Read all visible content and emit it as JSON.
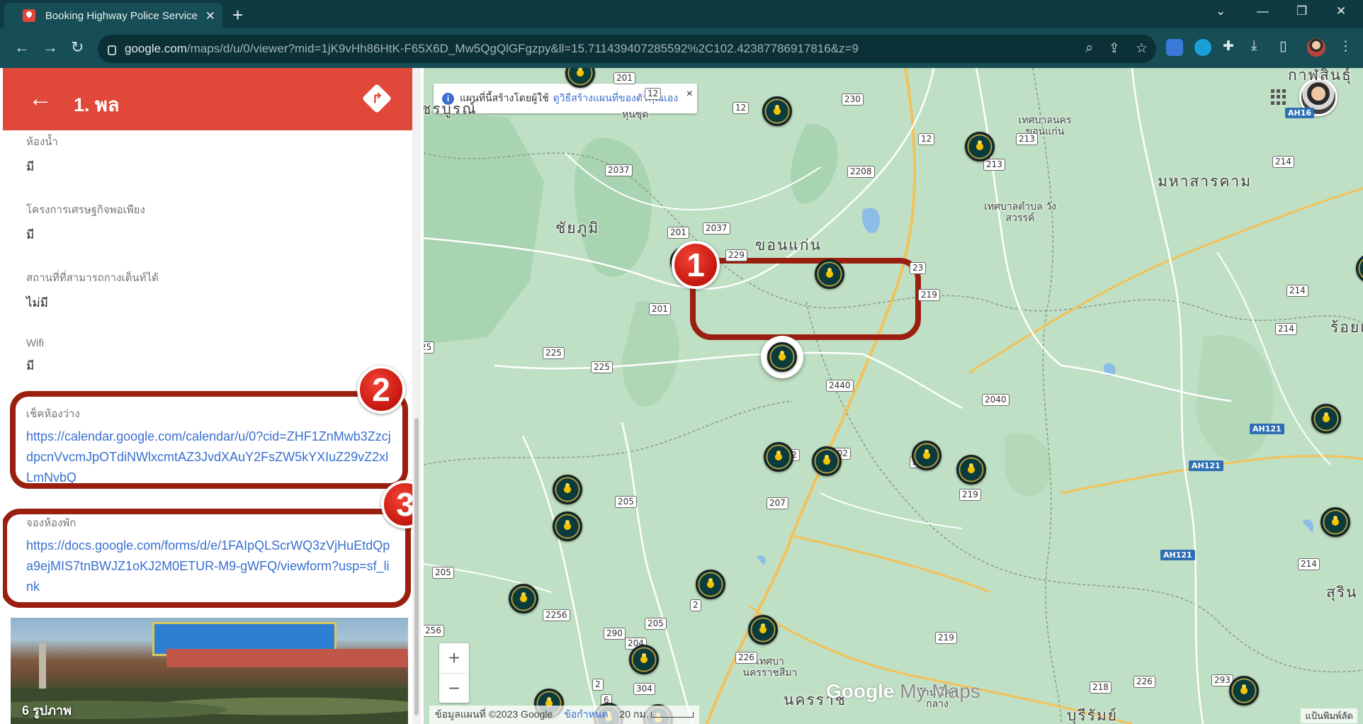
{
  "browser": {
    "tab_title": "Booking Highway Police Service",
    "url_host": "google.com",
    "url_path": "/maps/d/u/0/viewer?mid=1jK9vHh86HtK-F65X6D_Mw5QgQlGFgzpy&ll=15.711439407285592%2C102.42387786917816&z=9",
    "icons": {
      "back": "back-arrow-icon",
      "forward": "forward-arrow-icon",
      "reload": "reload-icon",
      "zoom": "zoom-icon",
      "share": "share-icon",
      "bookmark": "star-icon",
      "extensions": "puzzle-icon",
      "download": "download-icon",
      "sidepanel": "sidepanel-icon"
    }
  },
  "panel": {
    "title": "1. พล",
    "fields": [
      {
        "label": "ห้องน้ำ",
        "value": "มี"
      },
      {
        "label": "โครงการเศรษฐกิจพอเพียง",
        "value": "มี"
      },
      {
        "label": "สถานที่ที่สามารถกางเต็นท์ได้",
        "value": "ไม่มี"
      },
      {
        "label": "Wifi",
        "value": "มี"
      }
    ],
    "check_room": {
      "label": "เช็คห้องว่าง",
      "link": "https://calendar.google.com/calendar/u/0?cid=ZHF1ZnMwb3ZzcjdpcnVvcmJpOTdiNWlxcmtAZ3JvdXAuY2FsZW5kYXIuZ29vZ2xlLmNvbQ"
    },
    "book_room": {
      "label": "จองห้องพัก",
      "link": "https://docs.google.com/forms/d/e/1FAIpQLScrWQ3zVjHuEtdQpa9ejMIS7tnBWJZ1oKJ2M0ETUR-M9-gWFQ/viewform?usp=sf_link"
    },
    "photo_caption": "6 รูปภาพ",
    "badges": [
      "1",
      "2",
      "3"
    ]
  },
  "map": {
    "info_text": "แผนที่นี้สร้างโดยผู้ใช้",
    "info_link": "ดูวิธีสร้างแผนที่ของตัวคุณเอง",
    "info_close": "×",
    "zoom_in": "+",
    "zoom_out": "−",
    "watermark_google": "Google",
    "watermark_mymaps": "My Maps",
    "attribution": "ข้อมูลแผนที่ ©2023 Google",
    "terms": "ข้อกำหนด",
    "scale": "20 กม.",
    "print": "แป้นพิมพ์ลัด",
    "provinces": [
      "ชัยภูมิ",
      "ขอนแก่น",
      "มหาสารคาม",
      "ร้อยเ",
      "สุริน",
      "บุรีรัมย์",
      "ชรบูรณ์",
      "กาฬสินธุ์",
      "นครราช"
    ],
    "towns": [
      "เทศบาลนคร ขอนแก่น",
      "เทศบาลตำบล วังสวรรค์",
      "หุนซุด",
      "เทศบา นครราชสีมา",
      "บ้าน โคก กลาง"
    ],
    "road_shields": [
      "201",
      "12",
      "12",
      "230",
      "2037",
      "2037",
      "12",
      "213",
      "214",
      "213",
      "2208",
      "201",
      "229",
      "23",
      "219",
      "214",
      "214",
      "201",
      "225",
      "225",
      "2440",
      "2040",
      "202",
      "202",
      "202",
      "205",
      "207",
      "219",
      "205",
      "2256",
      "256",
      "290",
      "204",
      "205",
      "2",
      "226",
      "219",
      "214",
      "304",
      "2",
      "6",
      "218",
      "226",
      "293",
      "25"
    ],
    "ah_shields": [
      "AH16",
      "AH121",
      "AH121",
      "AH121"
    ]
  }
}
